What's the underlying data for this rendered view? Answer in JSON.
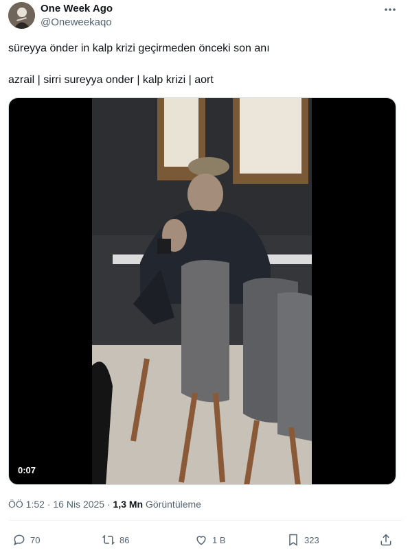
{
  "author": {
    "display_name": "One Week Ago",
    "handle": "@Oneweekaqo"
  },
  "tweet": {
    "text_line1": "süreyya önder in kalp krizi geçirmeden önceki son anı",
    "text_line2": "azrail | sirri sureyya onder  |  kalp krizi  |  aort"
  },
  "video": {
    "duration": "0:07"
  },
  "meta": {
    "time": "ÖÖ 1:52",
    "separator": " · ",
    "date": "16 Nis 2025",
    "separator2": " · ",
    "views_count": "1,3 Mn",
    "views_label": " Görüntüleme"
  },
  "actions": {
    "replies": "70",
    "reposts": "86",
    "likes": "1 B",
    "bookmarks": "323"
  },
  "icons": [
    "more-icon",
    "reply-icon",
    "repost-icon",
    "like-icon",
    "bookmark-icon",
    "share-icon"
  ]
}
